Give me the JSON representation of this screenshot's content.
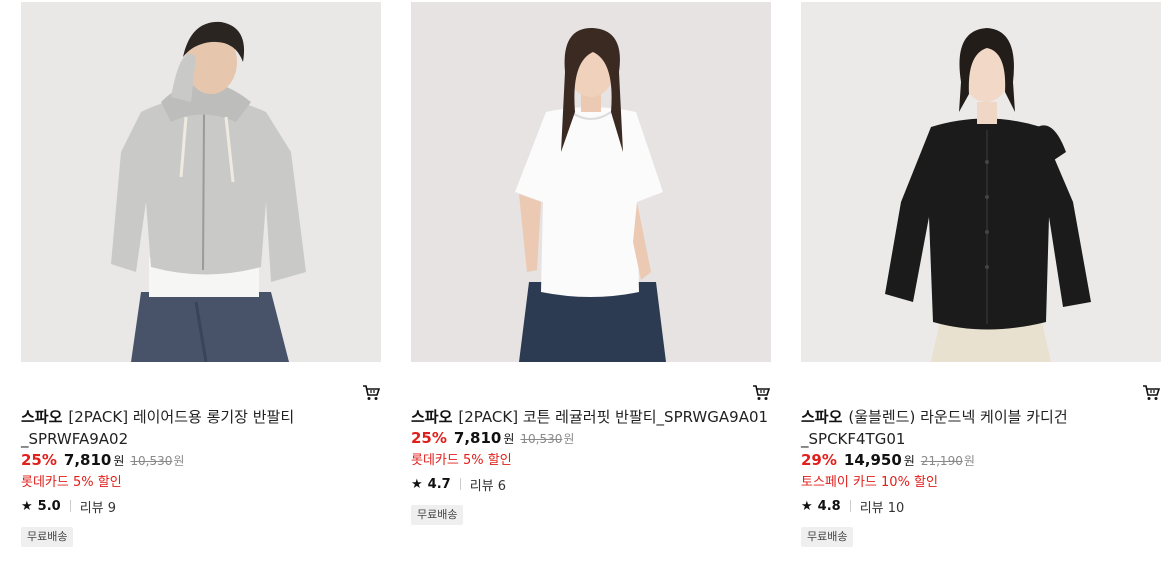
{
  "products": [
    {
      "brand": "스파오",
      "name": "[2PACK] 레이어드용 롱기장 반팔티",
      "code": "_SPRWFA9A02",
      "discount_rate": "25%",
      "price": "7,810",
      "currency": "원",
      "original_price": "10,530",
      "promo": "롯데카드 5% 할인",
      "rating": "5.0",
      "reviews": "리뷰 9",
      "badge": "무료배송",
      "image": "model-gray-zip-hoodie"
    },
    {
      "brand": "스파오",
      "name": "[2PACK] 코튼 레귤러핏 반팔티_SPRWGA9A01",
      "code": "",
      "discount_rate": "25%",
      "price": "7,810",
      "currency": "원",
      "original_price": "10,530",
      "promo": "롯데카드 5% 할인",
      "rating": "4.7",
      "reviews": "리뷰 6",
      "badge": "무료배송",
      "image": "model-white-tshirt"
    },
    {
      "brand": "스파오",
      "name": "(울블렌드) 라운드넥 케이블 카디건",
      "code": "_SPCKF4TG01",
      "discount_rate": "29%",
      "price": "14,950",
      "currency": "원",
      "original_price": "21,190",
      "promo": "토스페이 카드 10% 할인",
      "rating": "4.8",
      "reviews": "리뷰 10",
      "badge": "무료배송",
      "image": "model-black-cable-cardigan"
    }
  ],
  "colors": {
    "accent_red": "#e0201c",
    "photo_background": "#e9e8e6"
  },
  "icons": {
    "cart": "cart-icon",
    "star": "star-icon"
  }
}
